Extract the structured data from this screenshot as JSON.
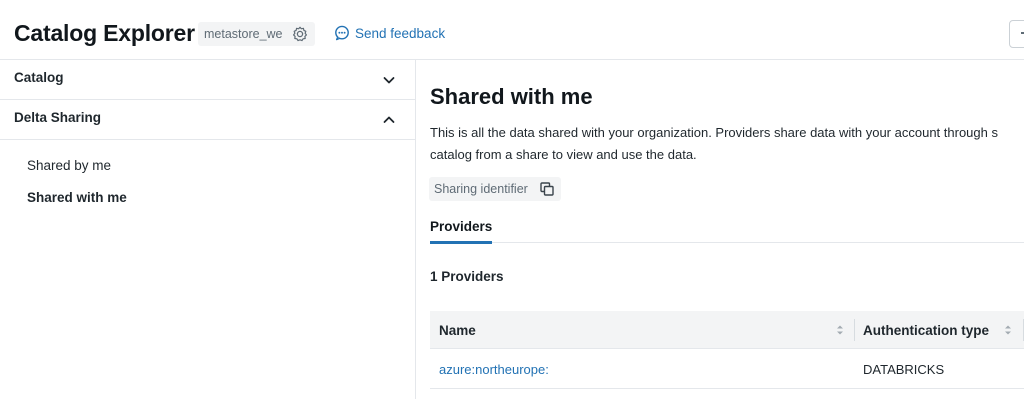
{
  "header": {
    "title": "Catalog Explorer",
    "metastore": "metastore_we",
    "settings_icon": "gear-icon",
    "feedback_label": "Send feedback",
    "feedback_icon": "chat-bubble-icon"
  },
  "sidebar": {
    "sections": [
      {
        "label": "Catalog",
        "state": "collapsed"
      },
      {
        "label": "Delta Sharing",
        "state": "expanded"
      }
    ],
    "items": [
      {
        "label": "Shared by me",
        "active": false
      },
      {
        "label": "Shared with me",
        "active": true
      }
    ]
  },
  "main": {
    "title": "Shared with me",
    "description_line1": "This is all the data shared with your organization. Providers share data with your account through s",
    "description_line2": "catalog from a share to view and use the data.",
    "sharing_identifier_label": "Sharing identifier",
    "copy_icon": "copy-icon",
    "tabs": [
      {
        "label": "Providers",
        "active": true
      }
    ],
    "providers_count": "1 Providers",
    "table": {
      "columns": [
        "Name",
        "Authentication type"
      ],
      "rows": [
        {
          "name": "azure:northeurope:",
          "auth_type": "DATABRICKS"
        }
      ]
    }
  },
  "colors": {
    "accent": "#2272b4",
    "text": "#1f272d",
    "muted": "#5f6b75",
    "chip_bg": "#f3f4f5",
    "border": "#e4e7eb"
  }
}
